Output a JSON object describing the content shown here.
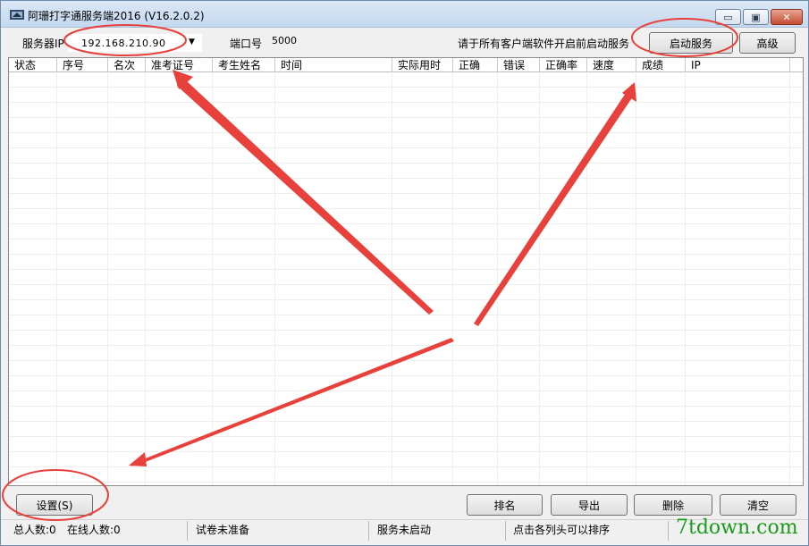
{
  "window": {
    "title": "阿珊打字通服务端2016 (V16.2.0.2)",
    "minimize_glyph": "▭",
    "maximize_glyph": "▣",
    "close_glyph": "✕"
  },
  "toolbar": {
    "server_ip_label": "服务器IP",
    "server_ip_value": "192.168.210.90",
    "port_label": "端口号",
    "port_value": "5000",
    "hint_text": "请于所有客户端软件开启前启动服务",
    "start_service_label": "启动服务",
    "advanced_label": "高级"
  },
  "table": {
    "columns": [
      "状态",
      "序号",
      "名次",
      "准考证号",
      "考生姓名",
      "时间",
      "实际用时",
      "正确",
      "错误",
      "正确率",
      "速度",
      "成绩",
      "IP"
    ],
    "rows": []
  },
  "actions": {
    "settings_label": "设置(S)",
    "rank_label": "排名",
    "export_label": "导出",
    "delete_label": "删除",
    "clear_label": "清空"
  },
  "status": {
    "total_label": "总人数:0",
    "online_label": "在线人数:0",
    "paper_status": "试卷未准备",
    "service_status": "服务未启动",
    "sort_hint": "点击各列头可以排序"
  },
  "watermark": {
    "text": "7tdown.com"
  },
  "colors": {
    "annotation_red": "#e8403a",
    "watermark_green": "#1a9a1a",
    "close_red": "#c74a32"
  },
  "icons": [
    "app-icon",
    "dropdown-arrow-icon",
    "minimize-icon",
    "maximize-icon",
    "close-icon"
  ]
}
